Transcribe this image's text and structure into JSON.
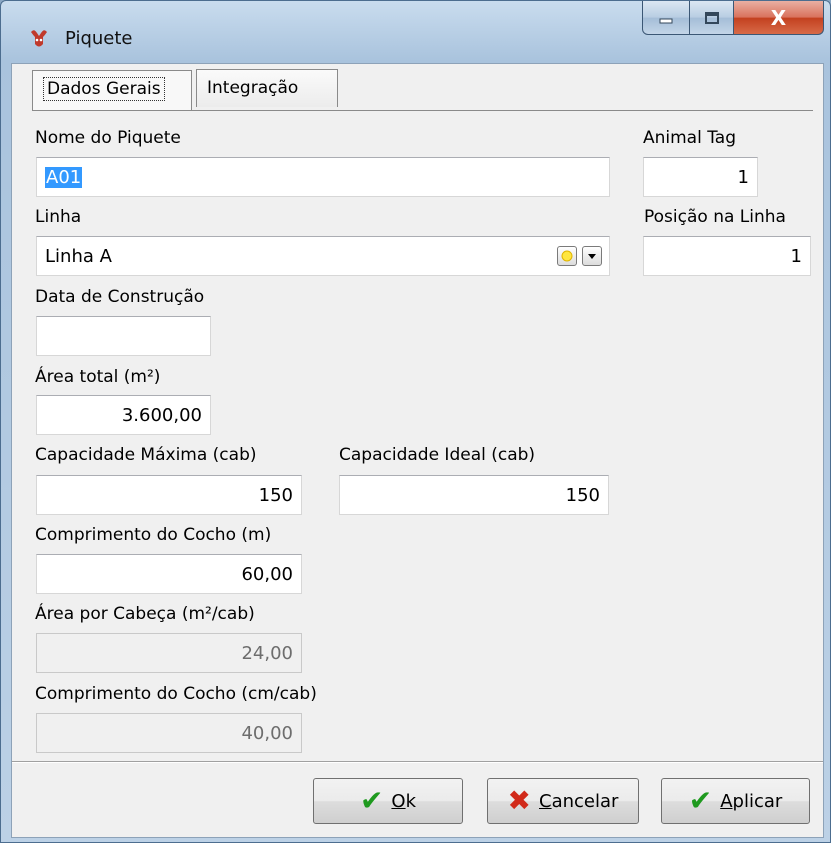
{
  "window": {
    "title": "Piquete",
    "close_glyph": "X"
  },
  "tabs": [
    {
      "label": "Dados Gerais",
      "active": true
    },
    {
      "label": "Integração",
      "active": false
    }
  ],
  "form": {
    "nome": {
      "label": "Nome do Piquete",
      "value": "A01"
    },
    "animal_tag": {
      "label": "Animal Tag",
      "value": "1"
    },
    "linha": {
      "label": "Linha",
      "value": "Linha A"
    },
    "posicao": {
      "label": "Posição na Linha",
      "value": "1"
    },
    "data_construcao": {
      "label": "Data de Construção",
      "value": ""
    },
    "area_total": {
      "label": "Área total (m²)",
      "value": "3.600,00"
    },
    "cap_maxima": {
      "label": "Capacidade Máxima (cab)",
      "value": "150"
    },
    "cap_ideal": {
      "label": "Capacidade Ideal (cab)",
      "value": "150"
    },
    "comp_cocho": {
      "label": "Comprimento do Cocho (m)",
      "value": "60,00"
    },
    "area_cabeca": {
      "label": "Área por Cabeça (m²/cab)",
      "value": "24,00"
    },
    "comp_cocho_cab": {
      "label": "Comprimento do Cocho (cm/cab)",
      "value": "40,00"
    }
  },
  "buttons": {
    "ok": {
      "label": "Ok",
      "key": "O",
      "rest": "k"
    },
    "cancel": {
      "label": "Cancelar",
      "key": "C",
      "rest": "ancelar"
    },
    "apply": {
      "label": "Aplicar",
      "key": "A",
      "rest": "plicar"
    }
  },
  "colors": {
    "selection": "#3399ff",
    "check_green": "#1f9a1f",
    "cancel_red": "#d12a1a",
    "close_red": "#c3401f"
  }
}
